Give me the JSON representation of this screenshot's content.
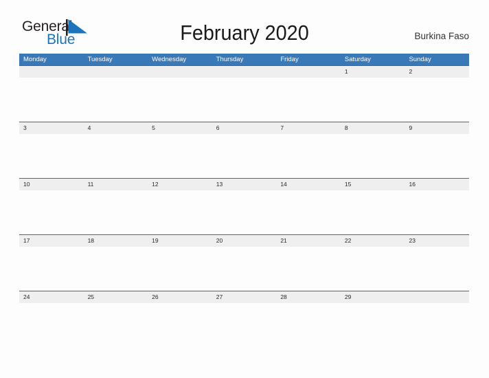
{
  "header": {
    "logo": {
      "word_one": "General",
      "word_two": "Blue",
      "flag_icon": "blue-flag-triangle"
    },
    "title": "February 2020",
    "subtitle": "Burkina Faso"
  },
  "colors": {
    "header_blue": "#3a79b8",
    "row_divider_blue": "#2e6da4",
    "date_strip_gray": "#efefef",
    "logo_blue": "#1b75bc",
    "logo_dark": "#231f20",
    "page_background": "#fdfdfd"
  },
  "calendar": {
    "month": "February",
    "year": "2020",
    "weekdays": [
      "Monday",
      "Tuesday",
      "Wednesday",
      "Thursday",
      "Friday",
      "Saturday",
      "Sunday"
    ],
    "weeks": [
      [
        "",
        "",
        "",
        "",
        "",
        "1",
        "2"
      ],
      [
        "3",
        "4",
        "5",
        "6",
        "7",
        "8",
        "9"
      ],
      [
        "10",
        "11",
        "12",
        "13",
        "14",
        "15",
        "16"
      ],
      [
        "17",
        "18",
        "19",
        "20",
        "21",
        "22",
        "23"
      ],
      [
        "24",
        "25",
        "26",
        "27",
        "28",
        "29",
        ""
      ]
    ]
  }
}
